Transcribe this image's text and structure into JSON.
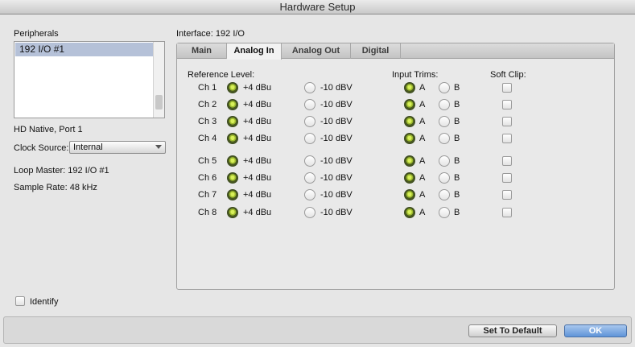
{
  "window": {
    "title": "Hardware Setup"
  },
  "left": {
    "peripherals_label": "Peripherals",
    "peripherals": [
      "192 I/O #1"
    ],
    "port_label": "HD Native, Port 1",
    "clock_source_label": "Clock Source:",
    "clock_source_value": "Internal",
    "loop_master": "Loop Master: 192 I/O #1",
    "sample_rate": "Sample Rate: 48 kHz",
    "identify_label": "Identify"
  },
  "interface_label": "Interface: 192 I/O",
  "tabs": [
    "Main",
    "Analog In",
    "Analog Out",
    "Digital"
  ],
  "active_tab": "Analog In",
  "headers": {
    "reference_level": "Reference Level:",
    "input_trims": "Input Trims:",
    "soft_clip": "Soft Clip:"
  },
  "options": {
    "plus4": "+4 dBu",
    "minus10": "-10 dBV",
    "a": "A",
    "b": "B"
  },
  "channels": [
    {
      "label": "Ch 1",
      "ref": "+4 dBu",
      "trim": "A",
      "soft_clip": false
    },
    {
      "label": "Ch 2",
      "ref": "+4 dBu",
      "trim": "A",
      "soft_clip": false
    },
    {
      "label": "Ch 3",
      "ref": "+4 dBu",
      "trim": "A",
      "soft_clip": false
    },
    {
      "label": "Ch 4",
      "ref": "+4 dBu",
      "trim": "A",
      "soft_clip": false
    },
    {
      "label": "Ch 5",
      "ref": "+4 dBu",
      "trim": "A",
      "soft_clip": false
    },
    {
      "label": "Ch 6",
      "ref": "+4 dBu",
      "trim": "A",
      "soft_clip": false
    },
    {
      "label": "Ch 7",
      "ref": "+4 dBu",
      "trim": "A",
      "soft_clip": false
    },
    {
      "label": "Ch 8",
      "ref": "+4 dBu",
      "trim": "A",
      "soft_clip": false
    }
  ],
  "buttons": {
    "set_default": "Set To Default",
    "ok": "OK"
  },
  "colors": {
    "radio_selected": "#9fbd2e",
    "ok_button": "#5f94d8",
    "list_selection": "#b5c1d8"
  }
}
